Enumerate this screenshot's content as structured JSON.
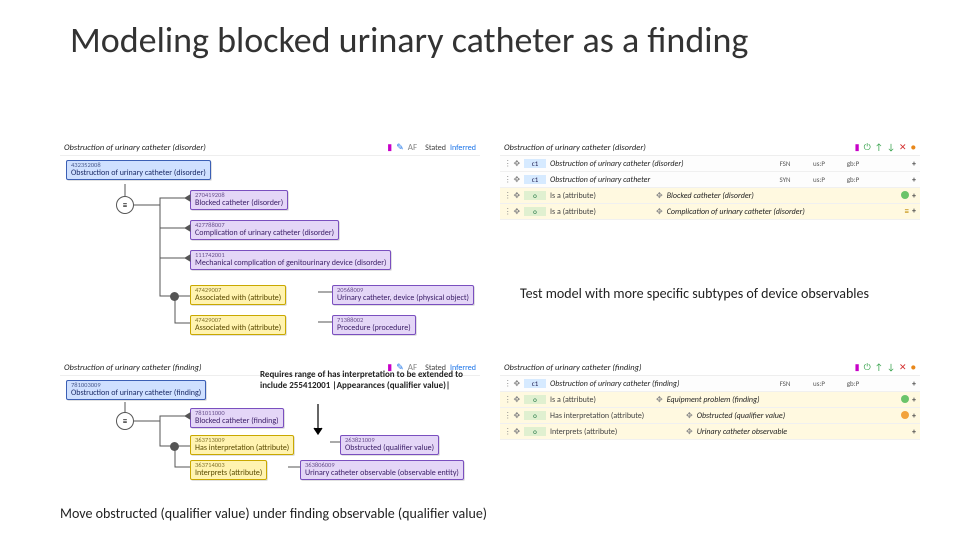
{
  "title": "Modeling blocked urinary catheter as a finding",
  "panel_tl": {
    "header": "Obstruction of urinary catheter (disorder)",
    "root": {
      "id": "432352008",
      "label": "Obstruction of urinary catheter (disorder)"
    },
    "parents": [
      {
        "id": "270419208",
        "label": "Blocked catheter (disorder)"
      },
      {
        "id": "427788007",
        "label": "Complication of urinary catheter (disorder)"
      },
      {
        "id": "111742001",
        "label": "Mechanical complication of genitourinary device (disorder)"
      }
    ],
    "rels": [
      {
        "attr": {
          "id": "47429007",
          "label": "Associated with (attribute)"
        },
        "val": {
          "id": "20568009",
          "label": "Urinary catheter, device (physical object)"
        }
      },
      {
        "attr": {
          "id": "47429007",
          "label": "Associated with (attribute)"
        },
        "val": {
          "id": "71388002",
          "label": "Procedure (procedure)"
        }
      }
    ]
  },
  "panel_tr": {
    "header": "Obstruction of urinary catheter (disorder)",
    "rows": [
      {
        "tag": "c1",
        "txt": "Obstruction of urinary catheter (disorder)",
        "c1": "FSN",
        "c2": "us:P",
        "c3": "gb:P"
      },
      {
        "tag": "c1",
        "txt": "Obstruction of urinary catheter",
        "c1": "SYN",
        "c2": "us:P",
        "c3": "gb:P"
      },
      {
        "tag": "o",
        "label": true,
        "txt": "Is a (attribute)",
        "val": "Blocked catheter (disorder)",
        "dot": "green"
      },
      {
        "tag": "o",
        "label": true,
        "txt": "Is a (attribute)",
        "val": "Complication of urinary catheter (disorder)",
        "eq": true
      }
    ]
  },
  "mid_note": "Test model with more specific subtypes of device observables",
  "panel_bl": {
    "header": "Obstruction of urinary catheter (finding)",
    "root": {
      "id": "781003009",
      "label": "Obstruction of urinary catheter (finding)"
    },
    "parents": [
      {
        "id": "781011000",
        "label": "Blocked catheter (finding)"
      }
    ],
    "rels": [
      {
        "attr": {
          "id": "363713009",
          "label": "Has interpretation (attribute)"
        },
        "val": {
          "id": "263821009",
          "label": "Obstructed (qualifier value)"
        }
      },
      {
        "attr": {
          "id": "363714003",
          "label": "Interprets (attribute)"
        },
        "val": {
          "id": "363806009",
          "label": "Urinary catheter observable (observable entity)"
        }
      }
    ]
  },
  "panel_br": {
    "header": "Obstruction of urinary catheter (finding)",
    "rows": [
      {
        "tag": "c1",
        "txt": "Obstruction of urinary catheter (finding)",
        "c1": "FSN",
        "c2": "us:P",
        "c3": "gb:P"
      },
      {
        "tag": "o",
        "label": true,
        "txt": "Is a (attribute)",
        "val": "Equipment problem (finding)",
        "dot": "green"
      },
      {
        "tag": "o",
        "label": true,
        "txt": "Has interpretation (attribute)",
        "val": "Obstructed (qualifier value)",
        "dot": "orange"
      },
      {
        "tag": "o",
        "label": true,
        "txt": "Interprets (attribute)",
        "val": "Urinary catheter observable"
      }
    ]
  },
  "small_note": "Requires range of has interpretation to be extended to include 255412001 |Appearances (qualifier value)|",
  "bottom_note": "Move obstructed (qualifier value) under finding observable (qualifier value)"
}
